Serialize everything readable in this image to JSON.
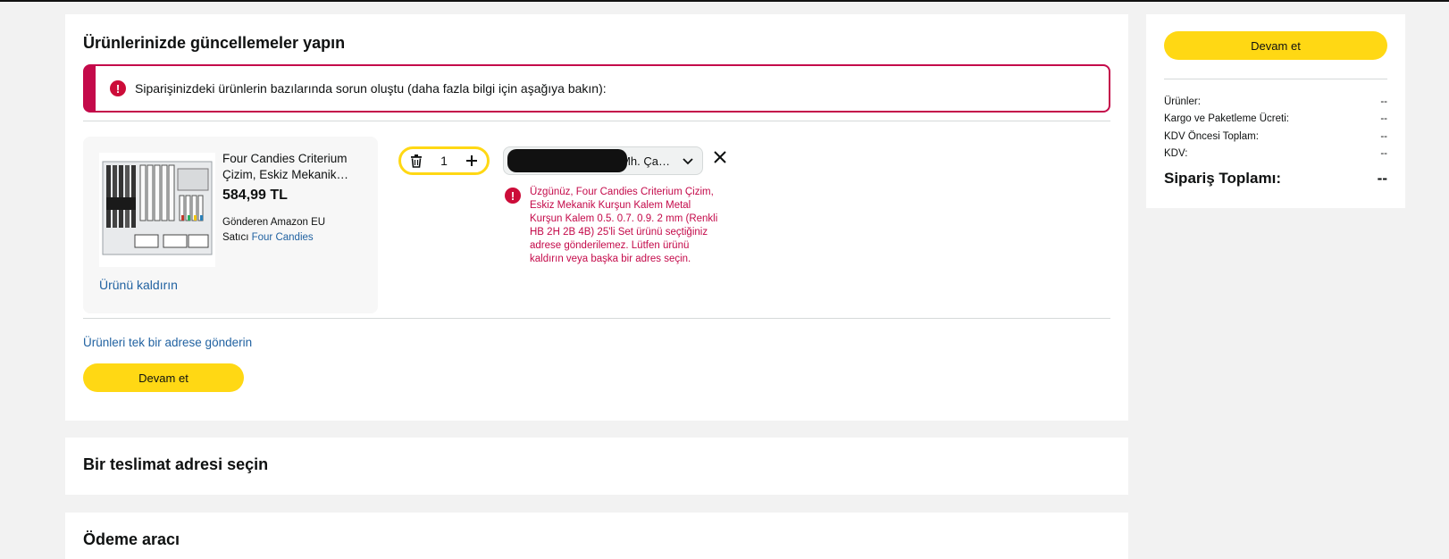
{
  "main": {
    "title": "Ürünlerinizde güncellemeler yapın",
    "alert_text": "Siparişinizdeki ürünlerin bazılarında sorun oluştu (daha fazla bilgi için aşağıya bakın):",
    "product": {
      "name": "Four Candies Criterium Çizim, Eskiz Mekanik…",
      "price": "584,99 TL",
      "ship_by": "Gönderen Amazon EU",
      "seller_prefix": "Satıcı",
      "seller_name": "Four Candies",
      "remove_label": "Ürünü kaldırın"
    },
    "quantity": "1",
    "address_select_text": "Mh. Ça…",
    "error_text": "Üzgünüz, Four Candies Criterium Çizim, Eskiz Mekanik Kurşun Kalem Metal Kurşun Kalem 0.5. 0.7. 0.9. 2 mm (Renkli HB 2H 2B 4B) 25'li Set ürünü seçtiğiniz adrese gönderilemez. Lütfen ürünü kaldırın veya başka bir adres seçin.",
    "ship_single_link": "Ürünleri tek bir adrese gönderin",
    "continue_label": "Devam et"
  },
  "address_section": {
    "title": "Bir teslimat adresi seçin"
  },
  "payment_section": {
    "title": "Ödeme aracı"
  },
  "summary": {
    "continue_label": "Devam et",
    "rows": [
      {
        "label": "Ürünler:",
        "value": "--"
      },
      {
        "label": "Kargo ve Paketleme Ücreti:",
        "value": "--"
      },
      {
        "label": "KDV Öncesi Toplam:",
        "value": "--"
      },
      {
        "label": "KDV:",
        "value": "--"
      }
    ],
    "total_label": "Sipariş Toplamı:",
    "total_value": "--"
  },
  "icons": {
    "alert": "exclamation-circle-icon",
    "trash": "trash-icon",
    "plus": "plus-icon",
    "chevron": "chevron-down-icon",
    "close": "close-icon"
  },
  "colors": {
    "accent_yellow": "#ffd814",
    "alert_red": "#c40a4a",
    "link_blue": "#2162a1"
  }
}
